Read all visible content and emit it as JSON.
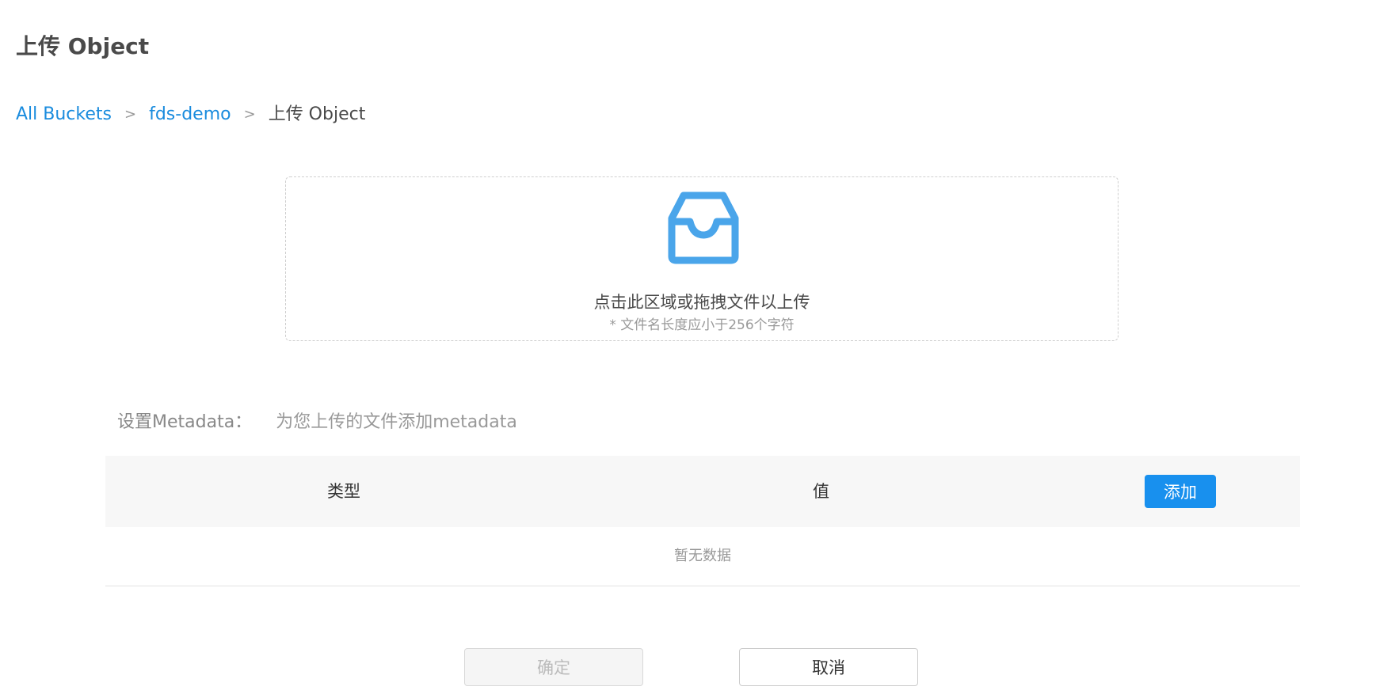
{
  "header": {
    "title": "上传 Object"
  },
  "breadcrumb": {
    "items": [
      {
        "label": "All Buckets"
      },
      {
        "label": "fds-demo"
      },
      {
        "label": "上传 Object"
      }
    ],
    "separator": ">"
  },
  "upload": {
    "icon": "inbox-icon",
    "text": "点击此区域或拖拽文件以上传",
    "hint": "* 文件名长度应小于256个字符",
    "accent_color": "#4aa5ea"
  },
  "metadata": {
    "label": "设置Metadata：",
    "description": "为您上传的文件添加metadata",
    "table": {
      "columns": [
        "类型",
        "值"
      ],
      "add_label": "添加",
      "empty_text": "暂无数据"
    }
  },
  "footer": {
    "confirm_label": "确定",
    "cancel_label": "取消"
  },
  "colors": {
    "link": "#1a8cde",
    "primary_button": "#1890ee"
  }
}
